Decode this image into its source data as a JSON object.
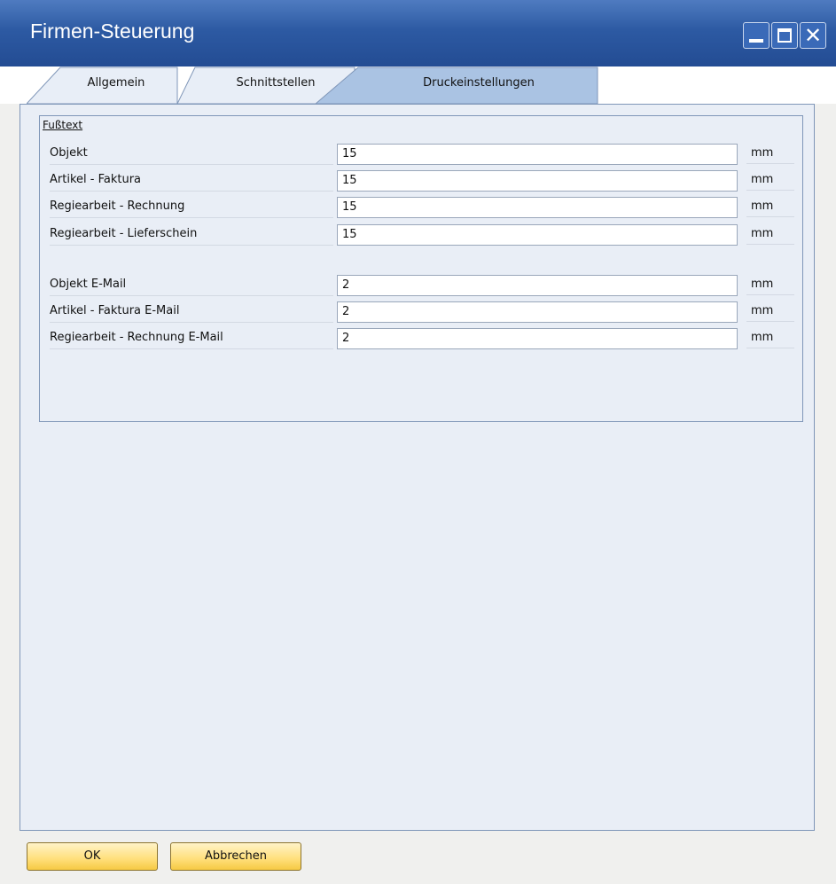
{
  "window": {
    "title": "Firmen-Steuerung"
  },
  "tabs": [
    {
      "label": "Allgemein"
    },
    {
      "label": "Schnittstellen"
    },
    {
      "label": "Druckeinstellungen"
    }
  ],
  "group": {
    "title": "Fußtext",
    "rows": [
      {
        "label": "Objekt",
        "value": "15",
        "unit": "mm"
      },
      {
        "label": "Artikel - Faktura",
        "value": "15",
        "unit": "mm"
      },
      {
        "label": "Regiearbeit - Rechnung",
        "value": "15",
        "unit": "mm"
      },
      {
        "label": "Regiearbeit - Lieferschein",
        "value": "15",
        "unit": "mm"
      },
      {
        "label": "Objekt E-Mail",
        "value": "2",
        "unit": "mm"
      },
      {
        "label": "Artikel - Faktura E-Mail",
        "value": "2",
        "unit": "mm"
      },
      {
        "label": "Regiearbeit - Rechnung E-Mail",
        "value": "2",
        "unit": "mm"
      }
    ]
  },
  "buttons": {
    "ok": "OK",
    "cancel": "Abbrechen"
  },
  "colors": {
    "titlebar": "#2d5aa3",
    "tab_active": "#aac3e3",
    "panel": "#e9eef6",
    "button": "#ffdf7a"
  }
}
